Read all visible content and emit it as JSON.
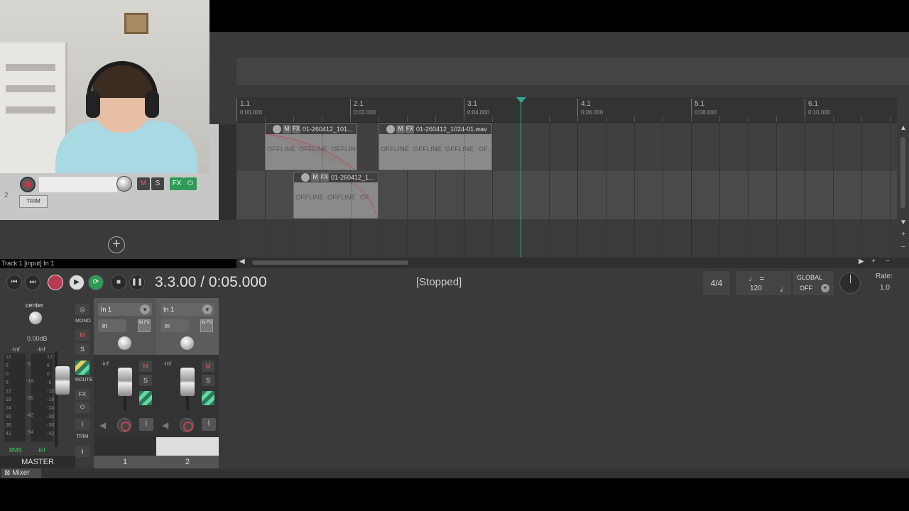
{
  "ruler": {
    "marks": [
      {
        "bar": "1.1",
        "time": "0:00.000"
      },
      {
        "bar": "2.1",
        "time": "0:02.000"
      },
      {
        "bar": "3.1",
        "time": "0:04.000"
      },
      {
        "bar": "4.1",
        "time": "0:06.000"
      },
      {
        "bar": "5.1",
        "time": "0:08.000"
      },
      {
        "bar": "6.1",
        "time": "0:10.000"
      }
    ]
  },
  "items": [
    {
      "name": "01-260412_101...",
      "offline": [
        "OFFLINE",
        "OFFLINE",
        "OFFLINE"
      ]
    },
    {
      "name": "01-260412_1024-01.wav",
      "offline": [
        "OFFLINE",
        "OFFLINE",
        "OFFLINE",
        "OF..."
      ]
    },
    {
      "name": "01-260412_1...",
      "offline": [
        "OFFLINE",
        "OFFLINE",
        "OF..."
      ]
    }
  ],
  "item_buttons": {
    "mute": "M",
    "fx": "FX"
  },
  "tcp": {
    "track_number": "2",
    "mute": "M",
    "solo": "S",
    "fx": "FX",
    "fx_power": "⏻",
    "trim": "TRIM"
  },
  "status_line": "Track 1 [input] In 1",
  "transport": {
    "timecode": "3.3.00 / 0:05.000",
    "state": "[Stopped]",
    "time_signature": "4/4",
    "tempo": "120",
    "global_label": "GLOBAL",
    "global_value": "OFF",
    "rate_label": "Rate:",
    "rate_value": "1.0",
    "icons": [
      "skip-back-icon",
      "skip-forward-icon",
      "record-icon",
      "play-icon",
      "repeat-icon",
      "stop-icon",
      "pause-icon"
    ]
  },
  "master": {
    "pan": "center",
    "gain": "0.00dB",
    "left_peak": "-Inf",
    "right_peak": "-Inf",
    "scale_left": [
      "12",
      "6",
      "0",
      "6",
      "12",
      "18",
      "24",
      "30",
      "36",
      "42"
    ],
    "scale_mid": [
      "-6",
      "-18",
      "-30",
      "-42",
      "-54"
    ],
    "scale_right": [
      "12",
      "6",
      "0",
      "-6",
      "-12",
      "-18",
      "-24",
      "-30",
      "-36",
      "-42"
    ],
    "rms_label": "RMS",
    "rms_value": "-Inf",
    "name": "MASTER",
    "side": {
      "mono": "MONO",
      "mute": "M",
      "solo": "S",
      "route": "ROUTE",
      "fx": "FX",
      "trim": "TRIM",
      "info": "i"
    }
  },
  "strips": [
    {
      "input": "In 1",
      "mode": "in",
      "fx_label": "IN FX",
      "inf": "-inf",
      "mute": "M",
      "solo": "S",
      "number": "1"
    },
    {
      "input": "In 1",
      "mode": "in",
      "fx_label": "IN FX",
      "inf": "-inf",
      "mute": "M",
      "solo": "S",
      "number": "2"
    }
  ],
  "mixer_tab": "Mixer",
  "colors": {
    "accent": "#2fa89a",
    "record": "#b83a50",
    "fx_green": "#3ecf6e"
  }
}
